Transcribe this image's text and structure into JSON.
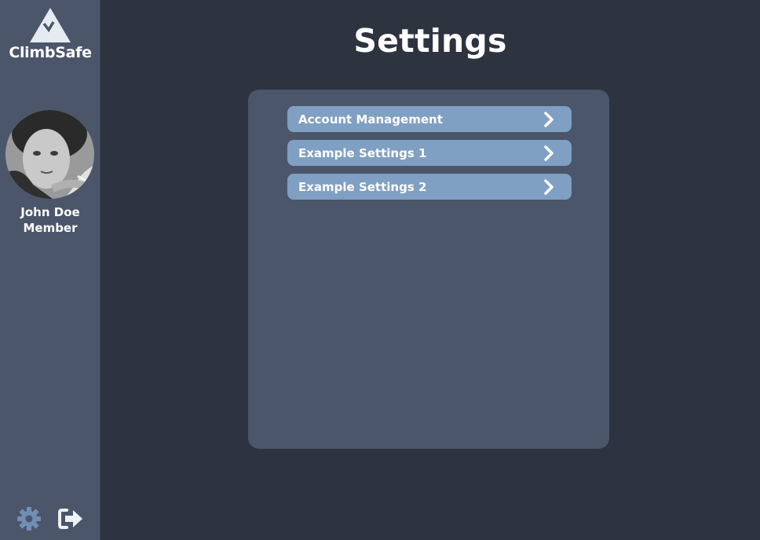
{
  "app": {
    "name": "ClimbSafe"
  },
  "user": {
    "name": "John Doe",
    "role": "Member"
  },
  "page": {
    "title": "Settings"
  },
  "settings": {
    "items": [
      {
        "label": "Account Management",
        "icon": "chevron-right-icon"
      },
      {
        "label": "Example Settings 1",
        "icon": "chevron-right-icon"
      },
      {
        "label": "Example Settings 2",
        "icon": "chevron-right-icon"
      }
    ]
  },
  "sidebar_actions": {
    "settings_icon": "gear-icon",
    "logout_icon": "logout-icon"
  },
  "colors": {
    "background": "#2e3340",
    "sidebar": "#4b566b",
    "panel": "#4b566b",
    "menu_item": "#7f9fc3",
    "icon_accent": "#6f8fb5",
    "text": "#ffffff"
  }
}
